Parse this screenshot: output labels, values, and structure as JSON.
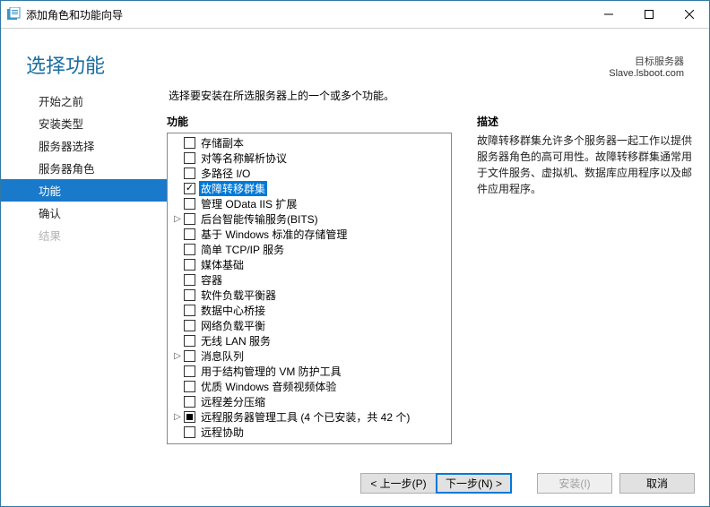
{
  "window": {
    "title": "添加角色和功能向导"
  },
  "header": {
    "title": "选择功能",
    "dest_label": "目标服务器",
    "dest_value": "Slave.lsboot.com"
  },
  "nav": {
    "items": [
      {
        "label": "开始之前",
        "state": "normal"
      },
      {
        "label": "安装类型",
        "state": "normal"
      },
      {
        "label": "服务器选择",
        "state": "normal"
      },
      {
        "label": "服务器角色",
        "state": "normal"
      },
      {
        "label": "功能",
        "state": "selected"
      },
      {
        "label": "确认",
        "state": "normal"
      },
      {
        "label": "结果",
        "state": "disabled"
      }
    ]
  },
  "main": {
    "instruction": "选择要安装在所选服务器上的一个或多个功能。",
    "features_header": "功能",
    "desc_header": "描述",
    "desc_body": "故障转移群集允许多个服务器一起工作以提供服务器角色的高可用性。故障转移群集通常用于文件服务、虚拟机、数据库应用程序以及邮件应用程序。"
  },
  "features": [
    {
      "label": "存储副本",
      "checked": "none",
      "expand": "",
      "selected": false
    },
    {
      "label": "对等名称解析协议",
      "checked": "none",
      "expand": "",
      "selected": false
    },
    {
      "label": "多路径 I/O",
      "checked": "none",
      "expand": "",
      "selected": false
    },
    {
      "label": "故障转移群集",
      "checked": "checked",
      "expand": "",
      "selected": true
    },
    {
      "label": "管理 OData IIS 扩展",
      "checked": "none",
      "expand": "",
      "selected": false
    },
    {
      "label": "后台智能传输服务(BITS)",
      "checked": "none",
      "expand": "▷",
      "selected": false
    },
    {
      "label": "基于 Windows 标准的存储管理",
      "checked": "none",
      "expand": "",
      "selected": false
    },
    {
      "label": "简单 TCP/IP 服务",
      "checked": "none",
      "expand": "",
      "selected": false
    },
    {
      "label": "媒体基础",
      "checked": "none",
      "expand": "",
      "selected": false
    },
    {
      "label": "容器",
      "checked": "none",
      "expand": "",
      "selected": false
    },
    {
      "label": "软件负载平衡器",
      "checked": "none",
      "expand": "",
      "selected": false
    },
    {
      "label": "数据中心桥接",
      "checked": "none",
      "expand": "",
      "selected": false
    },
    {
      "label": "网络负载平衡",
      "checked": "none",
      "expand": "",
      "selected": false
    },
    {
      "label": "无线 LAN 服务",
      "checked": "none",
      "expand": "",
      "selected": false
    },
    {
      "label": "消息队列",
      "checked": "none",
      "expand": "▷",
      "selected": false
    },
    {
      "label": "用于结构管理的 VM 防护工具",
      "checked": "none",
      "expand": "",
      "selected": false
    },
    {
      "label": "优质 Windows 音频视频体验",
      "checked": "none",
      "expand": "",
      "selected": false
    },
    {
      "label": "远程差分压缩",
      "checked": "none",
      "expand": "",
      "selected": false
    },
    {
      "label": "远程服务器管理工具 (4 个已安装，共 42 个)",
      "checked": "partial",
      "expand": "▷",
      "selected": false
    },
    {
      "label": "远程协助",
      "checked": "none",
      "expand": "",
      "selected": false
    }
  ],
  "footer": {
    "prev": "< 上一步(P)",
    "next": "下一步(N) >",
    "install": "安装(I)",
    "cancel": "取消"
  }
}
